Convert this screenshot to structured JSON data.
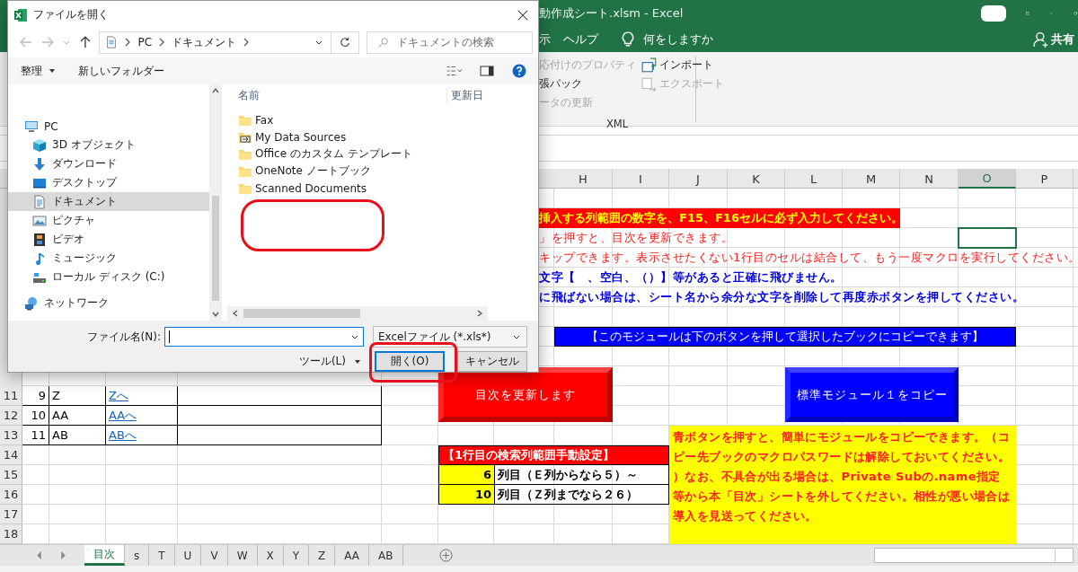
{
  "excel": {
    "title": "動作成シート.xlsm  -  Excel",
    "menu": [
      "示",
      "ヘルプ"
    ],
    "tell_me": "何をしますか",
    "share": "共有",
    "ribbon": {
      "commands": [
        {
          "label": "応付けのプロパティ",
          "disabled": true,
          "kind": "text"
        },
        {
          "label": "張パック",
          "disabled": false,
          "kind": "text"
        },
        {
          "label": "ータの更新",
          "disabled": true,
          "kind": "text"
        },
        {
          "label": "インポート",
          "disabled": false,
          "kind": "import"
        },
        {
          "label": "エクスポート",
          "disabled": true,
          "kind": "export"
        }
      ],
      "group": "XML"
    },
    "sheet": {
      "columns": [
        {
          "label": "H",
          "selected": false
        },
        {
          "label": "I",
          "selected": false
        },
        {
          "label": "J",
          "selected": false
        },
        {
          "label": "K",
          "selected": false
        },
        {
          "label": "L",
          "selected": false
        },
        {
          "label": "M",
          "selected": false
        },
        {
          "label": "N",
          "selected": false
        },
        {
          "label": "O",
          "selected": true
        },
        {
          "label": "P",
          "selected": false
        }
      ],
      "row_numbers": [
        "11",
        "12",
        "13",
        "14",
        "15",
        "16",
        "17",
        "18"
      ],
      "banner": "挿入する列範囲の数字を、F15、F16セルに必ず入力してください。",
      "notes": [
        {
          "kind": "caution",
          "text": "」を押すと、目次を更新できます。"
        },
        {
          "kind": "caution",
          "text": "キップできます。表示させたくない1行目のセルは結合して、もう一度マクロを実行してください。"
        },
        {
          "kind": "tip",
          "text": "文字【　、空白、（）】等があると正確に飛びません。"
        },
        {
          "kind": "tip",
          "text": "に飛ばない場合は、シート名から余分な文字を削除して再度赤ボタンを押してください。"
        }
      ],
      "module_banner": "【このモジュールは下のボタンを押して選択したブックにコピーできます】",
      "macro_buttons": [
        {
          "label": "目次を更新します",
          "color": "#ff0000"
        },
        {
          "label": "標準モジュール１をコピー",
          "color": "#0000ff"
        }
      ],
      "index_rows": [
        {
          "number": "9",
          "sheet": "Z",
          "link": "Zへ"
        },
        {
          "number": "10",
          "sheet": "AA",
          "link": "AAへ"
        },
        {
          "number": "11",
          "sheet": "AB",
          "link": "ABへ"
        }
      ],
      "settings": {
        "title": "【1行目の検索列範囲手動設定】",
        "rows": [
          {
            "number": "6",
            "caption": "列目（Ｅ列からなら５）～"
          },
          {
            "number": "10",
            "caption": "列目（Ｚ列までなら２６）"
          }
        ]
      },
      "help_note": "青ボタンを押すと、簡単にモジュールをコピーできます。（コピー先ブックのマクロパスワードは解除しておいてください。）なお、不具合が出る場合は、Private Subの.name指定等から本「目次」シートを外してください。相性が悪い場合は導入を見送ってください。"
    },
    "tabs": [
      {
        "label": "目次",
        "selected": true
      },
      {
        "label": "s",
        "selected": false
      },
      {
        "label": "T",
        "selected": false
      },
      {
        "label": "U",
        "selected": false
      },
      {
        "label": "V",
        "selected": false
      },
      {
        "label": "W",
        "selected": false
      },
      {
        "label": "X",
        "selected": false
      },
      {
        "label": "Y",
        "selected": false
      },
      {
        "label": "Z",
        "selected": false
      },
      {
        "label": "AA",
        "selected": false
      },
      {
        "label": "AB",
        "selected": false
      }
    ]
  },
  "dialog": {
    "title": "ファイルを開く",
    "path": [
      "PC",
      "ドキュメント"
    ],
    "search": {
      "placeholder": "ドキュメントの検索"
    },
    "toolbar": {
      "organize": "整理",
      "new_folder": "新しいフォルダー"
    },
    "nav": [
      {
        "label": "PC",
        "kind": "pc",
        "selected": false,
        "children": [
          {
            "label": "3D オブジェクト",
            "kind": "cube",
            "selected": false
          },
          {
            "label": "ダウンロード",
            "kind": "download",
            "selected": false
          },
          {
            "label": "デスクトップ",
            "kind": "desktop",
            "selected": false
          },
          {
            "label": "ドキュメント",
            "kind": "document",
            "selected": true
          },
          {
            "label": "ピクチャ",
            "kind": "pictures",
            "selected": false
          },
          {
            "label": "ビデオ",
            "kind": "video",
            "selected": false
          },
          {
            "label": "ミュージック",
            "kind": "music",
            "selected": false
          },
          {
            "label": "ローカル ディスク (C:)",
            "kind": "drive",
            "selected": false
          }
        ]
      },
      {
        "label": "ネットワーク",
        "kind": "network",
        "selected": false
      }
    ],
    "columns": [
      "名前",
      "更新日"
    ],
    "files": [
      {
        "name": "Fax",
        "kind": "folder"
      },
      {
        "name": "My Data Sources",
        "kind": "datasource"
      },
      {
        "name": "Office のカスタム テンプレート",
        "kind": "folder"
      },
      {
        "name": "OneNote ノートブック",
        "kind": "folder"
      },
      {
        "name": "Scanned Documents",
        "kind": "folder"
      }
    ],
    "file_name_label": "ファイル名(N):",
    "file_type": "Excelファイル (*.xls*)",
    "tools": "ツール(L)",
    "open": "開く(O)",
    "cancel": "キャンセル"
  }
}
